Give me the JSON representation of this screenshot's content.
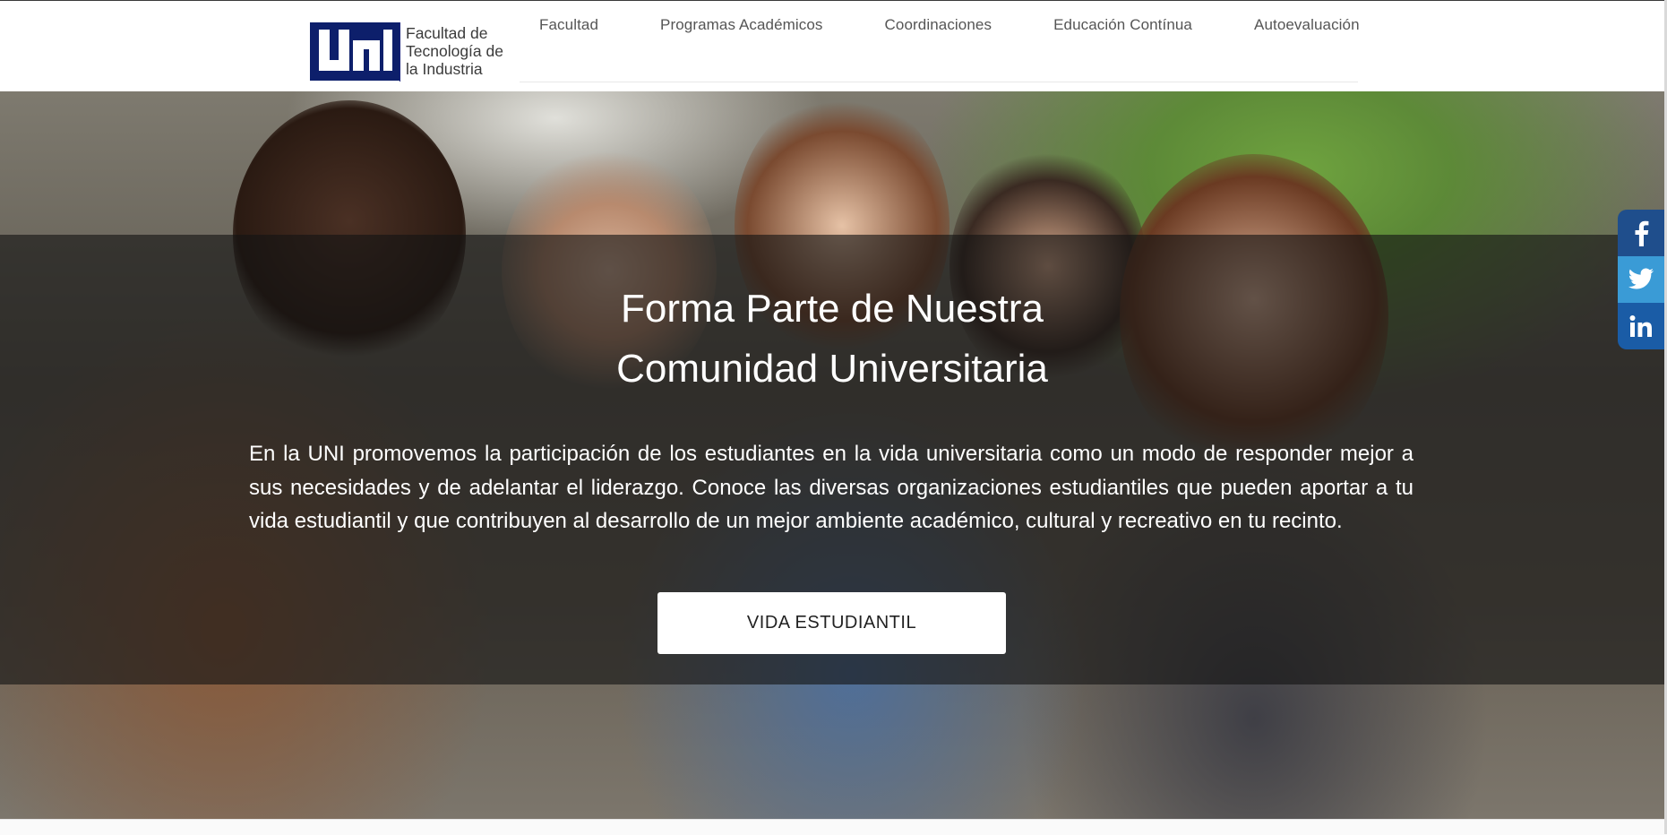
{
  "header": {
    "logo": {
      "mark_text": "UNI",
      "name_lines": [
        "Facultad de",
        "Tecnología de",
        "la Industria"
      ]
    },
    "nav": [
      {
        "label": "Facultad"
      },
      {
        "label": "Programas Académicos"
      },
      {
        "label": "Coordinaciones"
      },
      {
        "label": "Educación Contínua"
      },
      {
        "label": "Autoevaluación"
      }
    ]
  },
  "hero": {
    "title_lines": [
      "Forma Parte de Nuestra",
      "Comunidad Universitaria"
    ],
    "body": "En la UNI promovemos la participación de los estudiantes en la vida universitaria como un modo de responder mejor a sus necesidades y de adelantar el liderazgo. Conoce las diversas organizaciones estudiantiles que pueden aportar a tu vida estudiantil y que contribuyen al desarrollo de un mejor ambiente académico, cultural y recreativo en tu recinto.",
    "cta_label": "VIDA ESTUDIANTIL"
  },
  "social": [
    {
      "icon": "facebook-icon",
      "color": "#1f4e8c"
    },
    {
      "icon": "twitter-icon",
      "color": "#3a9bd6"
    },
    {
      "icon": "linkedin-icon",
      "color": "#1a5ca6"
    }
  ],
  "colors": {
    "brand_navy": "#0d1f6b",
    "overlay": "rgba(20,20,20,0.62)"
  }
}
